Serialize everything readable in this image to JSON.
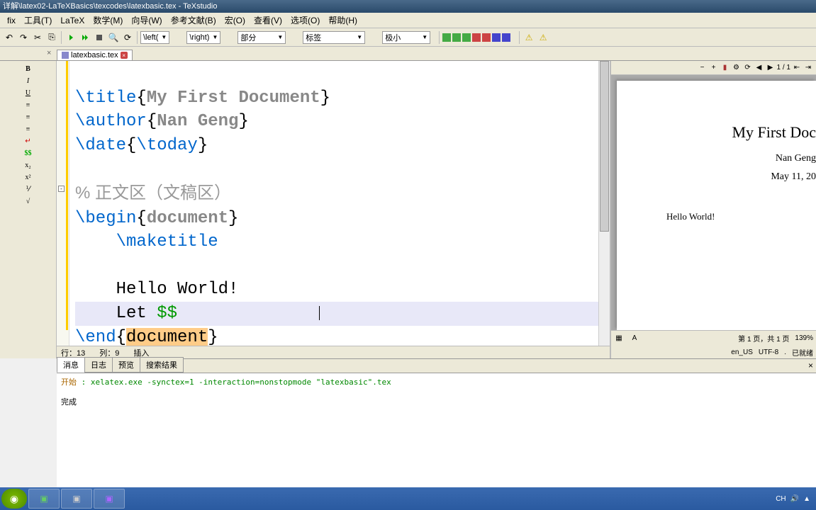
{
  "title": "详解\\latex02-LaTeXBasics\\texcodes\\latexbasic.tex - TeXstudio",
  "menu": [
    "fix",
    "工具(T)",
    "LaTeX",
    "数学(M)",
    "向导(W)",
    "参考文献(B)",
    "宏(O)",
    "查看(V)",
    "选项(O)",
    "帮助(H)"
  ],
  "combos": {
    "left": "\\left(",
    "right": "\\right)",
    "bufen": "部分",
    "biaoqian": "标签",
    "jixiao": "极小"
  },
  "tab": {
    "name": "latexbasic.tex"
  },
  "code": {
    "l1_cmd": "\\title",
    "l1_arg": "My First Document",
    "l2_cmd": "\\author",
    "l2_arg": "Nan Geng",
    "l3_cmd": "\\date",
    "l3_arg": "\\today",
    "cmt_pct": "%",
    "cmt_txt": " 正文区（文稿区）",
    "begin_cmd": "\\begin",
    "begin_arg": "document",
    "maketitle": "    \\maketitle",
    "hello": "    Hello World!",
    "let": "    Let ",
    "dollars": "$$",
    "end_cmd": "\\end",
    "end_arg": "document"
  },
  "status": {
    "row_lbl": "行：",
    "row": "13",
    "col_lbl": "列：",
    "col": "9",
    "mode": "插入"
  },
  "pv": {
    "pagenum": "1 / 1",
    "title": "My First Doc",
    "author": "Nan Geng",
    "date": "May 11, 20",
    "body": "Hello World!"
  },
  "pvstatus": {
    "pages": "第 1 页，共 1 页",
    "zoom": "139%",
    "lang": "en_US",
    "enc": "UTF-8",
    "dot": ".",
    "saved": "已就绪"
  },
  "msg": {
    "tabs": [
      "消息",
      "日志",
      "预览",
      "搜索结果"
    ],
    "start": "开始",
    "cmd": " : xelatex.exe -synctex=1 -interaction=nonstopmode \"latexbasic\".tex",
    "done": "完成"
  },
  "tray": {
    "ime": "CH",
    "time": ""
  }
}
